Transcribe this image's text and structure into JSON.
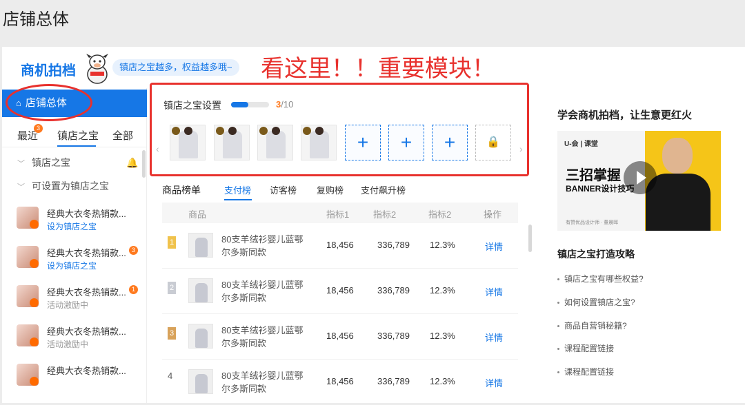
{
  "page_title": "店铺总体",
  "header": {
    "brand": "商机拍档",
    "bubble": "镇店之宝越多，权益越多哦~",
    "callout": "看这里！！重要模块！"
  },
  "sidebar": {
    "home_label": "店铺总体",
    "tabs": [
      "最近",
      "镇店之宝",
      "全部"
    ],
    "recent_badge": "3",
    "sections": [
      "镇店之宝",
      "可设置为镇店之宝"
    ],
    "items": [
      {
        "name": "经典大衣冬热销款...",
        "sub": "设为镇店之宝",
        "badge": ""
      },
      {
        "name": "经典大衣冬热销款...",
        "sub": "设为镇店之宝",
        "badge": "3"
      },
      {
        "name": "经典大衣冬热销款...",
        "sub": "活动激励中",
        "badge": "1"
      },
      {
        "name": "经典大衣冬热销款...",
        "sub": "活动激励中",
        "badge": ""
      },
      {
        "name": "经典大衣冬热销款...",
        "sub": "",
        "badge": ""
      }
    ]
  },
  "treasure": {
    "title": "镇店之宝设置",
    "current": "3",
    "total": "/10",
    "progress": 0.45,
    "empty_slot": "+"
  },
  "ranking": {
    "title": "商品榜单",
    "tabs": [
      "支付榜",
      "访客榜",
      "复购榜",
      "支付飙升榜"
    ],
    "headers": [
      "商品",
      "指标1",
      "指标2",
      "指标2",
      "操作"
    ],
    "rows": [
      {
        "rank": "1",
        "name": "80支羊绒衫婴儿蓝鄂尔多斯同款",
        "m1": "18,456",
        "m2": "336,789",
        "m3": "12.3%",
        "action": "详情"
      },
      {
        "rank": "2",
        "name": "80支羊绒衫婴儿蓝鄂尔多斯同款",
        "m1": "18,456",
        "m2": "336,789",
        "m3": "12.3%",
        "action": "详情"
      },
      {
        "rank": "3",
        "name": "80支羊绒衫婴儿蓝鄂尔多斯同款",
        "m1": "18,456",
        "m2": "336,789",
        "m3": "12.3%",
        "action": "详情"
      },
      {
        "rank": "4",
        "name": "80支羊绒衫婴儿蓝鄂尔多斯同款",
        "m1": "18,456",
        "m2": "336,789",
        "m3": "12.3%",
        "action": "详情"
      }
    ]
  },
  "right": {
    "title": "学会商机拍档，让生意更红火",
    "video": {
      "logo": "U-会 | 课堂",
      "line1": "三招掌握",
      "line2": "BANNER设计技巧",
      "line3": "有赞优品设计师 · 董晨晖"
    },
    "subtitle": "镇店之宝打造攻略",
    "tips": [
      "镇店之宝有哪些权益?",
      "如何设置镇店之宝?",
      "商品自营销秘籍?",
      "课程配置链接",
      "课程配置链接"
    ]
  },
  "colors": {
    "accent": "#1677e6",
    "callout": "#e8312d",
    "badge": "#ff7a1f"
  }
}
